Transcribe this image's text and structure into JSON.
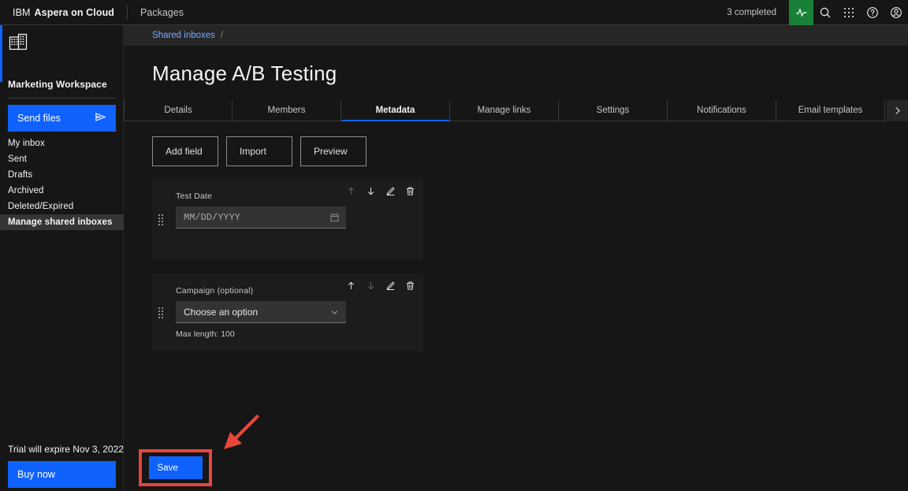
{
  "header": {
    "brand_ibm": "IBM",
    "brand_product": "Aspera on Cloud",
    "nav_link": "Packages",
    "completed_status": "3 completed",
    "icons": {
      "activity": "activity-icon",
      "search": "search-icon",
      "app_switcher": "app-switcher-icon",
      "help": "help-icon",
      "account": "account-icon"
    },
    "accent_green": "#198038"
  },
  "sidebar": {
    "workspace_icon": "building-icon",
    "workspace_name": "Marketing Workspace",
    "send_files_label": "Send files",
    "send_files_icon": "send-icon",
    "accent_blue": "#0f62fe",
    "nav_items": [
      {
        "label": "My inbox",
        "active": false
      },
      {
        "label": "Sent",
        "active": false
      },
      {
        "label": "Drafts",
        "active": false
      },
      {
        "label": "Archived",
        "active": false
      },
      {
        "label": "Deleted/Expired",
        "active": false
      },
      {
        "label": "Manage shared inboxes",
        "active": true
      }
    ],
    "trial_notice": "Trial will expire Nov 3, 2022",
    "buy_now_label": "Buy now"
  },
  "main": {
    "breadcrumb": {
      "link": "Shared inboxes",
      "separator": "/"
    },
    "page_title": "Manage A/B Testing",
    "tabs": [
      {
        "label": "Details",
        "active": false
      },
      {
        "label": "Members",
        "active": false
      },
      {
        "label": "Metadata",
        "active": true
      },
      {
        "label": "Manage links",
        "active": false
      },
      {
        "label": "Settings",
        "active": false
      },
      {
        "label": "Notifications",
        "active": false
      },
      {
        "label": "Email templates",
        "active": false
      }
    ],
    "tab_next_icon": "chevron-right-icon",
    "actions": [
      {
        "label": "Add field"
      },
      {
        "label": "Import"
      },
      {
        "label": "Preview"
      }
    ],
    "fields": [
      {
        "label": "Test Date",
        "value": "MM/DD/YYYY",
        "control": "date-input",
        "end_icon": "calendar-icon",
        "help": "",
        "move_up_enabled": false,
        "move_down_enabled": true
      },
      {
        "label": "Campaign (optional)",
        "value": "Choose an option",
        "control": "select",
        "end_icon": "chevron-down-icon",
        "help": "Max length: 100",
        "move_up_enabled": true,
        "move_down_enabled": false
      }
    ],
    "toolbar_icons": {
      "move_up": "arrow-up-icon",
      "move_down": "arrow-down-icon",
      "edit": "pencil-icon",
      "delete": "trash-icon"
    },
    "save_label": "Save",
    "highlight_color": "#e8453c"
  }
}
